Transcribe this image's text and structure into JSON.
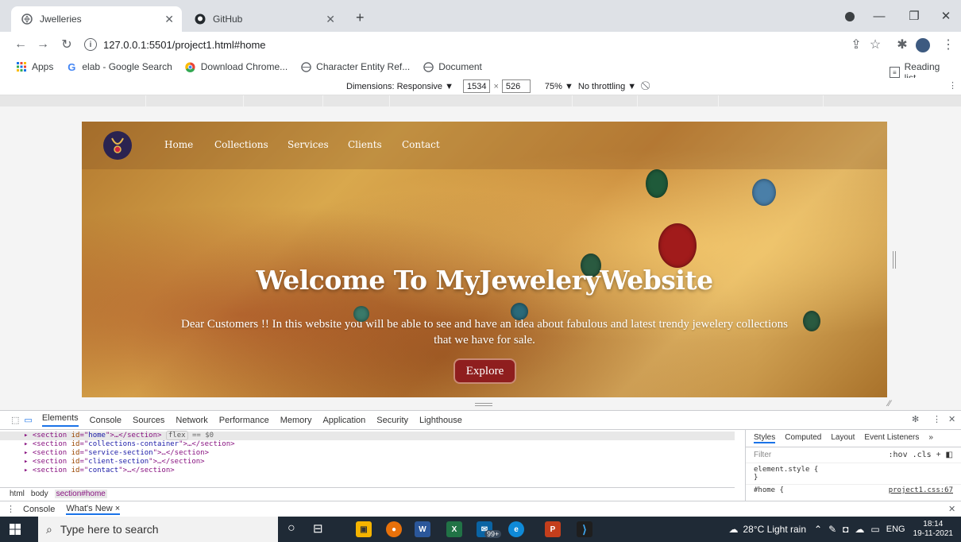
{
  "browser": {
    "tabs": [
      {
        "title": "Jwelleries",
        "active": true
      },
      {
        "title": "GitHub",
        "active": false
      }
    ],
    "new_tab": "+",
    "url": "127.0.0.1:5501/project1.html#home",
    "bookmarks": [
      {
        "label": "Apps",
        "icon": "apps-grid-icon"
      },
      {
        "label": "elab - Google Search",
        "icon": "google-icon"
      },
      {
        "label": "Download Chrome...",
        "icon": "chrome-icon"
      },
      {
        "label": "Character Entity Ref...",
        "icon": "globe-icon"
      },
      {
        "label": "Document",
        "icon": "globe-icon"
      }
    ],
    "reading_list": "Reading list"
  },
  "device_toolbar": {
    "dimensions_label": "Dimensions: Responsive ▼",
    "width": "1534",
    "times": "×",
    "height": "526",
    "zoom": "75% ▼",
    "throttling": "No throttling ▼"
  },
  "site": {
    "nav": [
      "Home",
      "Collections",
      "Services",
      "Clients",
      "Contact"
    ],
    "heading": "Welcome To MyJeweleryWebsite",
    "subtitle": "Dear Customers !! In this website you will be able to see and have an idea about fabulous and latest trendy jewelery collections that we have for sale.",
    "explore": "Explore"
  },
  "devtools": {
    "tabs": [
      "Elements",
      "Console",
      "Sources",
      "Network",
      "Performance",
      "Memory",
      "Application",
      "Security",
      "Lighthouse"
    ],
    "elements": [
      {
        "id": "home",
        "suffix": ">…</section>",
        "badge": "flex",
        "extra": "== $0",
        "selected": true
      },
      {
        "id": "collections-container",
        "suffix": ">…</section>",
        "selected": false
      },
      {
        "id": "service-section",
        "suffix": ">…</section>",
        "selected": false
      },
      {
        "id": "client-section",
        "suffix": ">…</section>",
        "selected": false
      },
      {
        "id": "contact",
        "suffix": ">…</section>",
        "selected": false
      }
    ],
    "breadcrumbs": [
      "html",
      "body",
      "section#home"
    ],
    "styles_tabs": [
      "Styles",
      "Computed",
      "Layout",
      "Event Listeners",
      "»"
    ],
    "filter_placeholder": "Filter",
    "hov_cls": ":hov .cls",
    "element_style": "element.style {",
    "close_brace": "}",
    "rule_selector": "#home {",
    "rule_source": "project1.css:67"
  },
  "drawer": {
    "tabs": [
      "Console",
      "What's New ×"
    ]
  },
  "taskbar": {
    "search_placeholder": "Type here to search",
    "badge": "99+",
    "weather": "28°C  Light rain",
    "lang": "ENG",
    "time": "18:14",
    "date": "19-11-2021"
  }
}
